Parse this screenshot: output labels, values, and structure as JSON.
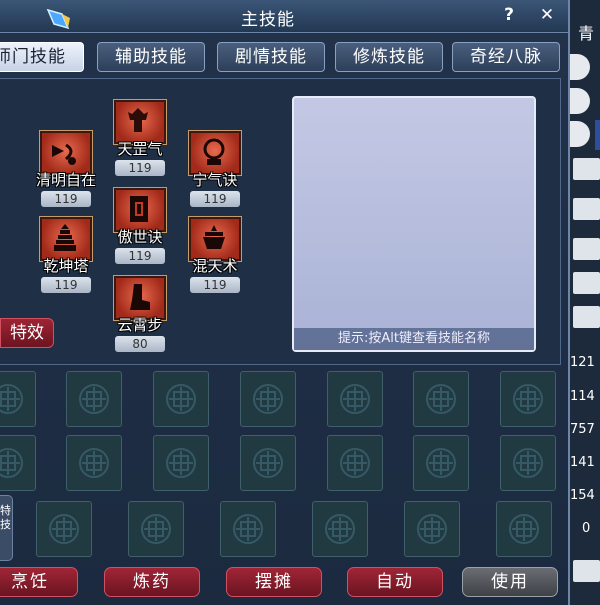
{
  "window": {
    "title": "主技能",
    "help_label": "?",
    "close_label": "✕"
  },
  "tabs": [
    {
      "label": "师门技能",
      "active": true
    },
    {
      "label": "辅助技能",
      "active": false
    },
    {
      "label": "剧情技能",
      "active": false
    },
    {
      "label": "修炼技能",
      "active": false
    },
    {
      "label": "奇经八脉",
      "active": false
    }
  ],
  "skills": [
    {
      "name": "天罡气",
      "level": "119",
      "icon": "demon-statue-icon"
    },
    {
      "name": "清明自在",
      "level": "119",
      "icon": "horn-icon"
    },
    {
      "name": "宁气诀",
      "level": "119",
      "icon": "orb-icon"
    },
    {
      "name": "傲世诀",
      "level": "119",
      "icon": "tower-gate-icon"
    },
    {
      "name": "乾坤塔",
      "level": "119",
      "icon": "pagoda-icon"
    },
    {
      "name": "混天术",
      "level": "119",
      "icon": "cauldron-icon"
    },
    {
      "name": "云霄步",
      "level": "80",
      "icon": "boot-icon"
    }
  ],
  "effects_label": "特效",
  "hint_text": "提示:按Alt键查看技能名称",
  "side_tab_label": "特技",
  "bottom_buttons": [
    {
      "label": "烹饪",
      "style": "red"
    },
    {
      "label": "炼药",
      "style": "red"
    },
    {
      "label": "摆摊",
      "style": "red"
    },
    {
      "label": "自动",
      "style": "red"
    },
    {
      "label": "使用",
      "style": "gray"
    }
  ],
  "right_panel": {
    "label": "青",
    "numbers": [
      "121",
      "114",
      "757",
      "141",
      "154",
      "0"
    ]
  },
  "colors": {
    "accent_red": "#9d2434",
    "panel_blue": "#1f2f45",
    "desc_bg": "#bcc3e0"
  }
}
